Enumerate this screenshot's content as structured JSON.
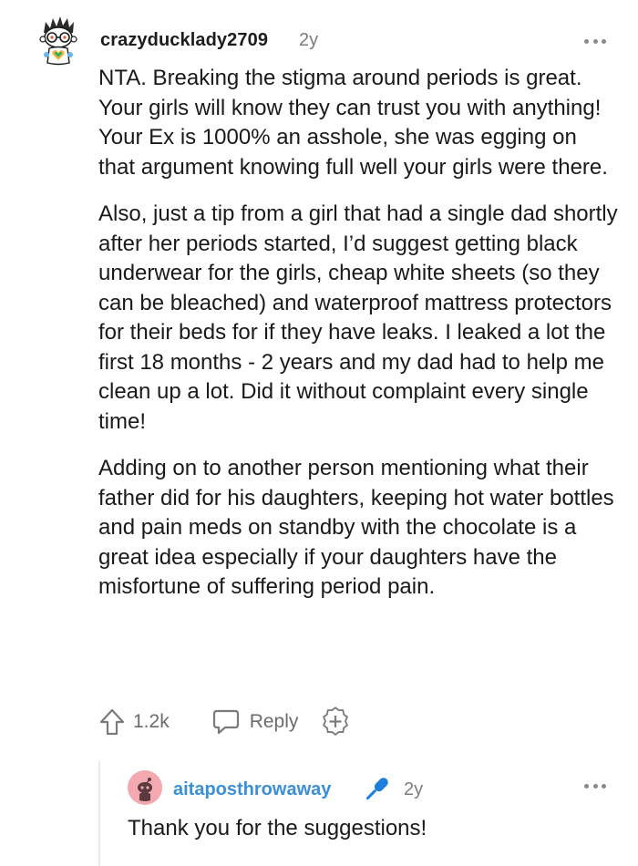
{
  "comment": {
    "username": "crazyducklady2709",
    "age": "2y",
    "avatar_icon": "snoo-avatar-icon",
    "paragraphs": [
      "NTA. Breaking the stigma around periods is great. Your girls will know they can trust you with anything! Your Ex is 1000% an asshole, she was egging on that argument knowing full well your girls were there.",
      "Also, just a tip from a girl that had a single dad shortly after her periods started, I’d suggest getting black underwear for the girls, cheap white sheets (so they can be bleached) and waterproof mattress protectors for their beds for if they have leaks. I leaked a lot the first 18 months - 2 years and my dad had to help me clean up a lot. Did it without complaint every single time!",
      "Adding on to another person mentioning what their father did for his daughters, keeping hot water bottles and pain meds on standby with the chocolate is a great idea especially if your daughters have the misfortune of suffering period pain."
    ],
    "upvotes": "1.2k",
    "reply_label": "Reply",
    "icons": [
      "upvote-icon",
      "reply-icon",
      "award-icon",
      "more-icon"
    ]
  },
  "reply": {
    "username": "aitaposthrowaway",
    "age": "2y",
    "avatar_icon": "snoo-avatar-icon",
    "flair_icon": "microphone-icon",
    "text": "Thank you for the suggestions!"
  },
  "colors": {
    "text": "#1a1a1b",
    "meta": "#7c7c7c",
    "reply_username": "#3a8fd6",
    "avatar_bg": "#f4a9b0",
    "thread_line": "#eaeaea"
  }
}
